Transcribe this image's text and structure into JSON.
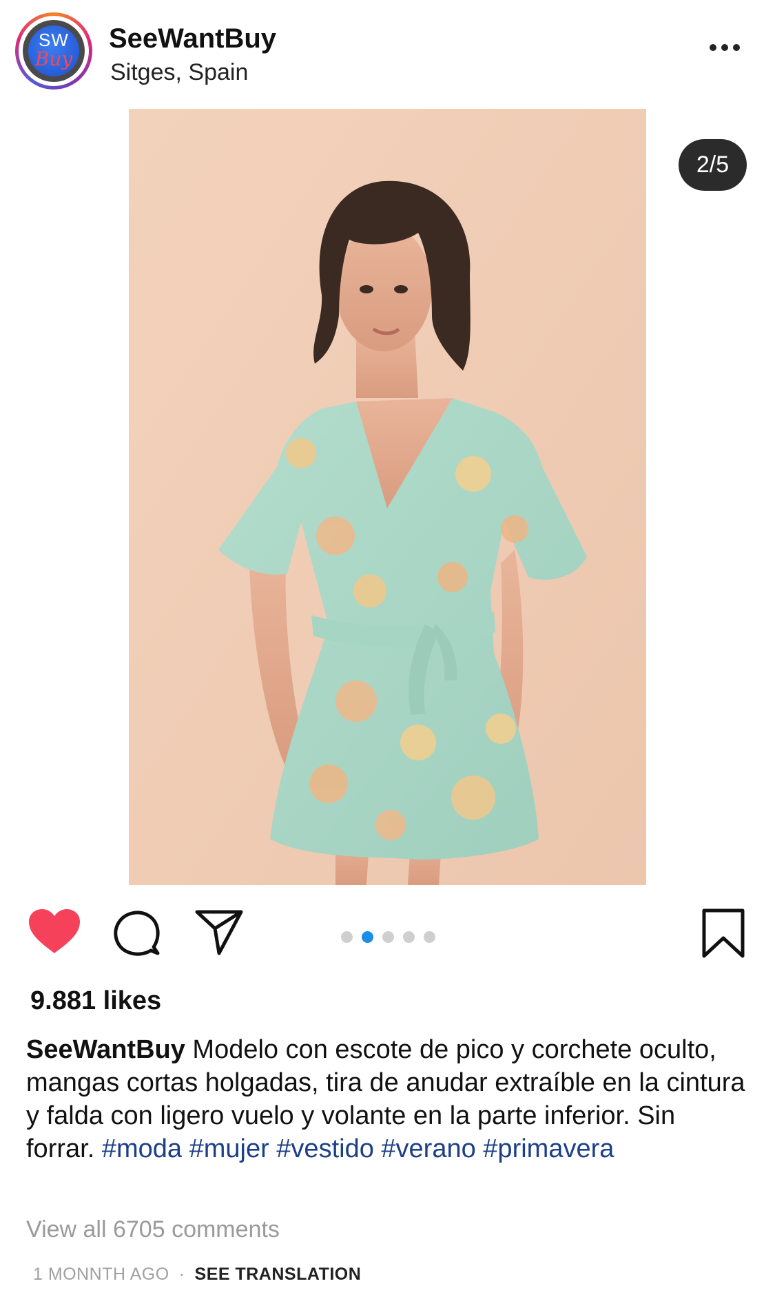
{
  "post": {
    "username": "SeeWantBuy",
    "location": "Sitges, Spain",
    "avatar_text_top": "SW",
    "avatar_text_bottom": "Buy",
    "image_counter": "2/5",
    "carousel": {
      "count": 5,
      "active_index": 1
    },
    "liked": true,
    "likes_text": "9.881 likes",
    "caption": {
      "user": "SeeWantBuy",
      "text": "Modelo con escote de pico y corchete oculto, mangas cortas holgadas, tira de anudar extraíble en la cintura y falda con ligero vuelo y volante en la parte inferior. Sin forrar.",
      "hashtags": [
        "#moda",
        "#mujer",
        "#vestido",
        "#verano",
        "#primavera"
      ]
    },
    "view_comments": "View all 6705 comments",
    "time_ago": "1 MONNTH AGO",
    "separator": "·",
    "see_translation": "SEE TRANSLATION"
  },
  "icons": {
    "more": "more-options-icon",
    "like": "heart-icon",
    "comment": "comment-icon",
    "share": "paper-plane-icon",
    "save": "bookmark-icon"
  },
  "colors": {
    "heart": "#f5425a",
    "hashtag": "#1c3f88",
    "carousel_active": "#1a8ee8",
    "carousel_inactive": "#cfcfcf",
    "muted_text": "#9a9a9a",
    "photo_background": "#f1cdb5",
    "dress": "#a9d6c6"
  }
}
